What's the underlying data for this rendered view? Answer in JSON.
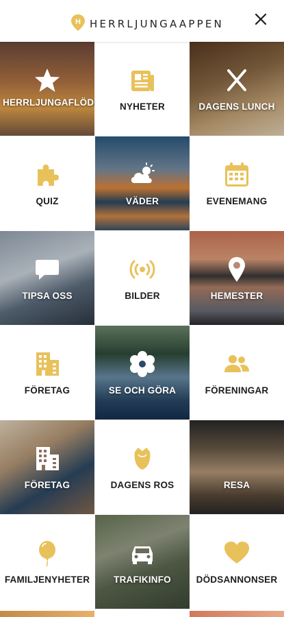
{
  "app": {
    "title": "HERRLJUNGAAPPEN",
    "accent_color": "#E8C15A",
    "logo_icon": "map-pin-h-icon",
    "close_icon": "close-icon"
  },
  "tiles": [
    {
      "label": "HERRLJUNGAFLÖDET",
      "icon": "star-icon",
      "style": "photo",
      "bg": "linear-gradient(180deg,#6f4a3e 0%,#b87845 45%,#e8a64c 70%,#7a5a45 100%)"
    },
    {
      "label": "NYHETER",
      "icon": "newspaper-icon",
      "style": "white"
    },
    {
      "label": "DAGENS LUNCH",
      "icon": "cutlery-icon",
      "style": "photo",
      "bg": "linear-gradient(160deg,#5c3b22 0%,#8b6a45 40%,#c9a77a 70%,#e7d6b8 100%)"
    },
    {
      "label": "QUIZ",
      "icon": "puzzle-icon",
      "style": "white"
    },
    {
      "label": "VÄDER",
      "icon": "cloud-sun-icon",
      "style": "photo",
      "bg": "linear-gradient(180deg,#2c5d83 0%,#7a8fa6 35%,#e48a3d 55%,#2c4a66 70%,#d88a48 85%,#3a556f 100%)"
    },
    {
      "label": "EVENEMANG",
      "icon": "calendar-icon",
      "style": "white"
    },
    {
      "label": "TIPSA OSS",
      "icon": "speech-bubble-icon",
      "style": "photo",
      "bg": "linear-gradient(160deg,#9aa7b7 0%,#cfd8e1 40%,#5f6f80 65%,#2f3a46 100%)"
    },
    {
      "label": "BILDER",
      "icon": "broadcast-icon",
      "style": "white"
    },
    {
      "label": "HEMESTER",
      "icon": "location-pin-icon",
      "style": "photo",
      "bg": "linear-gradient(180deg,#d27a58 0%,#e3a07d 30%,#3b3a3a 48%,#b5826a 60%,#6b6f78 85%,#2c2c2e 100%)"
    },
    {
      "label": "FÖRETAG",
      "icon": "buildings-icon",
      "style": "white"
    },
    {
      "label": "SE OCH GÖRA",
      "icon": "flower-icon",
      "style": "photo",
      "bg": "linear-gradient(180deg,#6f8a70 0%,#2f4d3a 30%,#6c8faa 55%,#2a4a6a 80%,#163050 100%)"
    },
    {
      "label": "FÖRENINGAR",
      "icon": "people-icon",
      "style": "white"
    },
    {
      "label": "FÖRETAG",
      "icon": "buildings-icon",
      "style": "photo",
      "bg": "linear-gradient(150deg,#e8d8c0 0%,#b89a78 35%,#2e4a66 65%,#8a6a52 100%)"
    },
    {
      "label": "DAGENS ROS",
      "icon": "rose-icon",
      "style": "white"
    },
    {
      "label": "RESA",
      "icon": "",
      "style": "photo",
      "bg": "linear-gradient(180deg,#2a2a2a 0%,#6a5a48 30%,#b89a7a 55%,#5a4a3a 80%,#2a2a2a 100%)"
    },
    {
      "label": "FAMILJENYHETER",
      "icon": "balloon-icon",
      "style": "white"
    },
    {
      "label": "TRAFIKINFO",
      "icon": "car-icon",
      "style": "photo",
      "bg": "linear-gradient(160deg,#6c7a5a 0%,#9aa08a 35%,#5e6a52 60%,#3e4a38 100%)"
    },
    {
      "label": "DÖDSANNONSER",
      "icon": "heart-icon",
      "style": "white"
    }
  ],
  "bottom_strips": [
    {
      "bg": "linear-gradient(90deg,#c48a4a,#e8b06a)"
    },
    {
      "bg": "#ffffff"
    },
    {
      "bg": "linear-gradient(90deg,#d07a5a,#e6a88a)"
    }
  ]
}
